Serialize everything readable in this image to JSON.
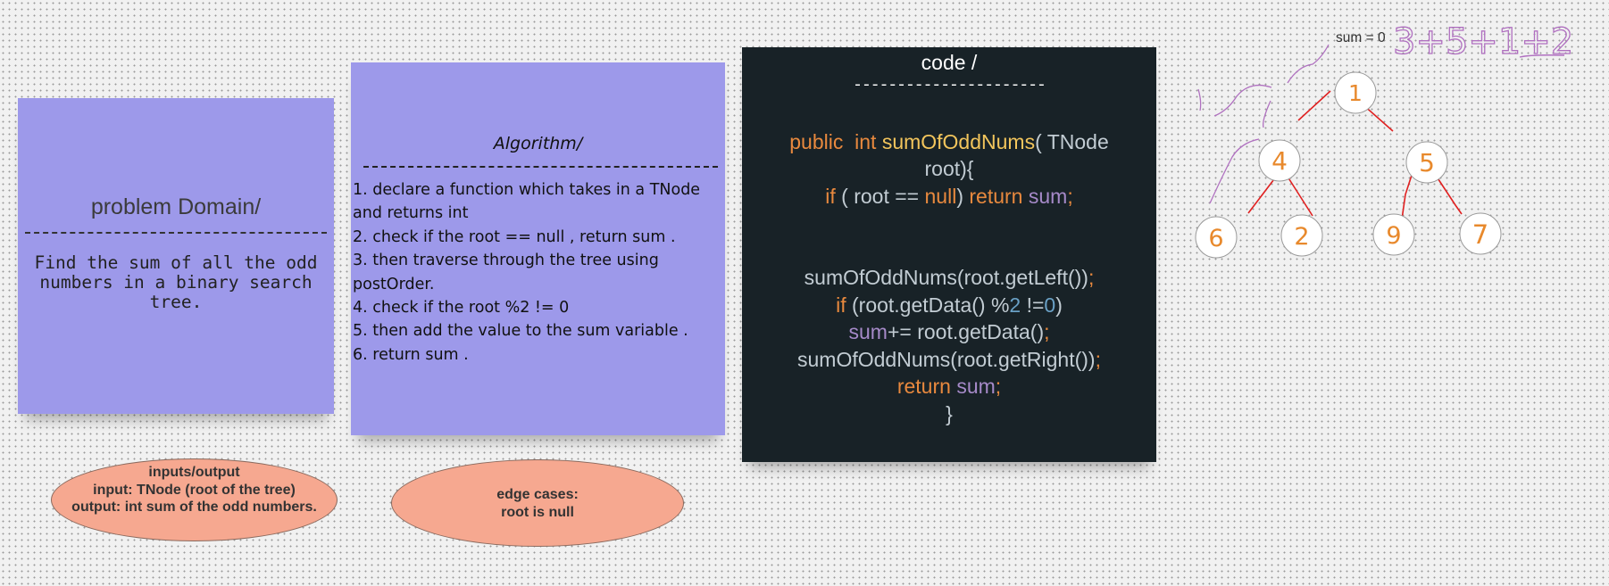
{
  "problem": {
    "title": "problem Domain/",
    "text": "Find the sum of all the odd numbers in a binary search tree."
  },
  "algorithm": {
    "title": "Algorithm/",
    "steps": [
      "1. declare a function which takes in a TNode",
      " and returns int",
      "2. check if the root == null , return sum .",
      "3. then traverse through the tree using",
      " postOrder.",
      "4. check if the root %2 != 0",
      "5. then add the value to the sum variable .",
      "6. return sum ."
    ]
  },
  "code": {
    "title": "code /",
    "dashes": "----------------------",
    "l1_kw": "public  int",
    "l1_fn": "sumOfOddNums",
    "l1_rest": "( TNode",
    "l2": "root){",
    "l3_if": "if",
    "l3_mid": "( root ==",
    "l3_null": "null",
    "l3_close": ")",
    "l3_ret": "return",
    "l3_sum": "sum",
    "l3_semi": ";",
    "l4": "sumOfOddNums(root.getLeft())",
    "l4_semi": ";",
    "l5_if": "if",
    "l5_a": "(root.getData() %",
    "l5_two": "2",
    "l5_b": "!=",
    "l5_zero": "0",
    "l5_c": ")",
    "l6_sum": "sum",
    "l6_rest": "+= root.getData()",
    "l6_semi": ";",
    "l7": "sumOfOddNums(root.getRight())",
    "l7_semi": ";",
    "l8_ret": "return",
    "l8_sum": "sum",
    "l8_semi": ";",
    "l9": "}"
  },
  "io": {
    "title": "inputs/output",
    "input": "input: TNode (root of the tree)",
    "output": "output: int sum of the odd numbers."
  },
  "edge": {
    "title": "edge cases:",
    "case": "root is null"
  },
  "tree": {
    "sum_label": "sum = 0",
    "sum_scribble": "3+5+1+2",
    "nodes": [
      "1",
      "4",
      "5",
      "6",
      "2",
      "9",
      "7"
    ],
    "colors": {
      "node_text": "#e8892c",
      "edge": "#e02020",
      "trace": "#b070c0"
    }
  }
}
